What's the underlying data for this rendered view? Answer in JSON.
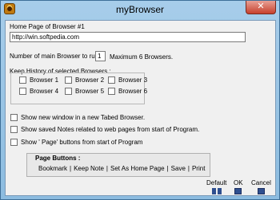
{
  "window": {
    "title": "myBrowser",
    "close_glyph": "✕",
    "icon": "app-icon"
  },
  "home": {
    "label": "Home Page of Browser #1",
    "url_value": "http://win.softpedia.com"
  },
  "main_browsers": {
    "label": "Number of main Browser to run :",
    "value": "1",
    "max_label": "Maximum 6 Browsers."
  },
  "history": {
    "label": "Keep History of selected Browsers :",
    "items": [
      {
        "label": "Browser 1",
        "checked": false
      },
      {
        "label": "Browser 2",
        "checked": false
      },
      {
        "label": "Browser 3",
        "checked": false
      },
      {
        "label": "Browser 4",
        "checked": false
      },
      {
        "label": "Browser 5",
        "checked": false
      },
      {
        "label": "Browser 6",
        "checked": false
      }
    ]
  },
  "options": [
    {
      "label": "Show new window in a new Tabed Browser.",
      "checked": false
    },
    {
      "label": "Show saved Notes related to web pages from start of Program.",
      "checked": false
    },
    {
      "label": "Show ' Page' buttons from start of Program",
      "checked": false
    }
  ],
  "page_buttons": {
    "title": "Page Buttons :",
    "links": [
      "Bookmark",
      "Keep Note",
      "Set As Home Page",
      "Save",
      "Print"
    ],
    "separator": "|"
  },
  "footer": {
    "default_label": "Default",
    "ok_label": "OK",
    "cancel_label": "Cancel"
  }
}
